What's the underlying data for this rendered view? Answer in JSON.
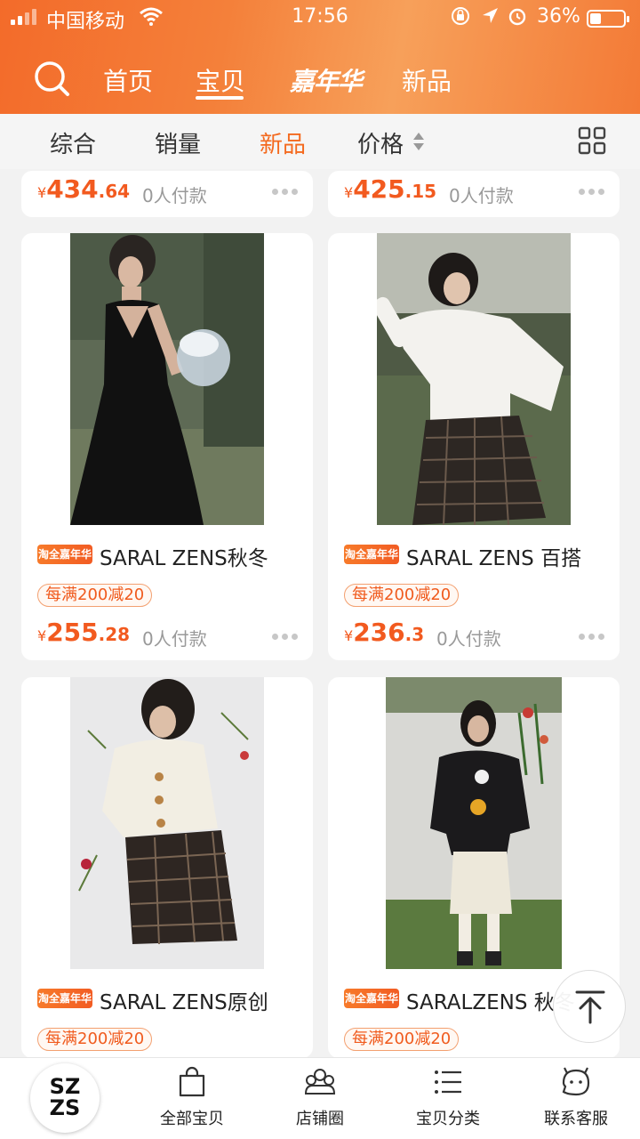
{
  "status_bar": {
    "carrier": "中国移动",
    "time": "17:56",
    "battery": "36%"
  },
  "nav": {
    "tabs": [
      "首页",
      "宝贝",
      "嘉年华",
      "新品"
    ],
    "active": "宝贝"
  },
  "sort": {
    "items": [
      "综合",
      "销量",
      "新品",
      "价格"
    ],
    "active": "新品"
  },
  "products_top_partial": [
    {
      "price_int": "434",
      "price_dec": ".64",
      "paid": "0人付款"
    },
    {
      "price_int": "425",
      "price_dec": ".15",
      "paid": "0人付款"
    }
  ],
  "products": [
    {
      "badge": "淘全嘉年华",
      "title": "SARAL ZENS秋冬",
      "coupon": "每满200减20",
      "price_int": "255",
      "price_dec": ".28",
      "paid": "0人付款"
    },
    {
      "badge": "淘全嘉年华",
      "title": "SARAL ZENS 百搭",
      "coupon": "每满200减20",
      "price_int": "236",
      "price_dec": ".3",
      "paid": "0人付款"
    },
    {
      "badge": "淘全嘉年华",
      "title": "SARAL ZENS原创",
      "coupon": "每满200减20"
    },
    {
      "badge": "淘全嘉年华",
      "title": "SARALZENS 秋冬",
      "coupon": "每满200减20"
    }
  ],
  "currency": "¥",
  "bottom_bar": {
    "logo": [
      "SZ",
      "ZS"
    ],
    "tabs": [
      "全部宝贝",
      "店铺圈",
      "宝贝分类",
      "联系客服"
    ]
  },
  "colors": {
    "accent": "#f46a1f",
    "header": "#f47c35"
  }
}
